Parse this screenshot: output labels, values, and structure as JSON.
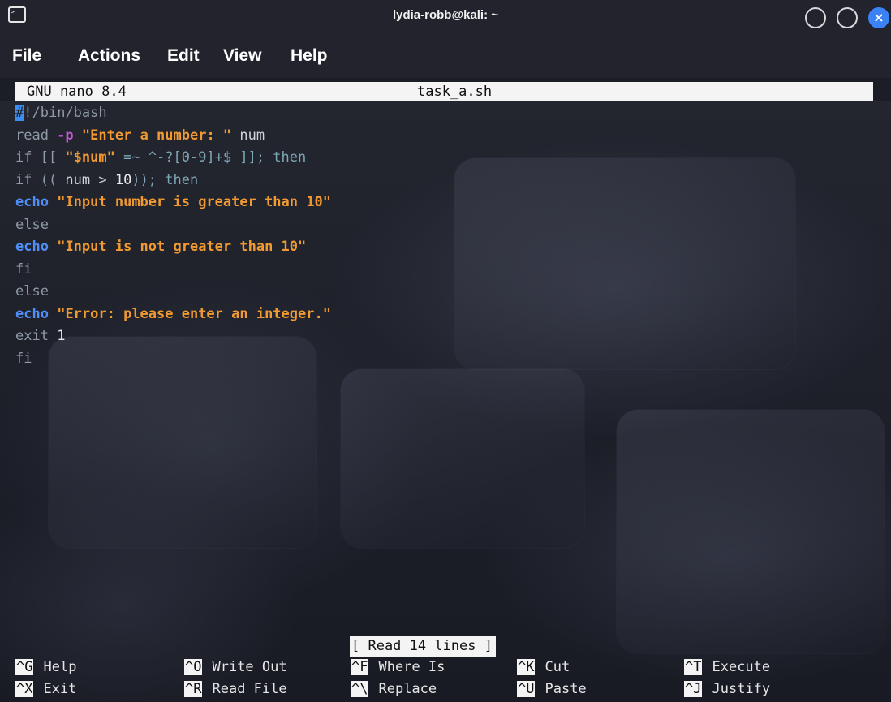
{
  "window": {
    "title": "lydia-robb@kali: ~",
    "icon": "terminal-icon",
    "controls": [
      "minimize",
      "maximize",
      "close"
    ]
  },
  "menu": [
    "File",
    "Actions",
    "Edit",
    "View",
    "Help"
  ],
  "nano": {
    "version": "GNU nano 8.4",
    "filename": "task_a.sh",
    "status": "[ Read 14 lines ]"
  },
  "code_lines": [
    [
      {
        "t": "#",
        "c": "cursor"
      },
      {
        "t": "!/bin/bash",
        "c": "c-grey"
      }
    ],
    [
      {
        "t": "read ",
        "c": "c-grey"
      },
      {
        "t": "-p",
        "c": "c-purple"
      },
      {
        "t": " ",
        "c": "c-plain"
      },
      {
        "t": "\"Enter a number: \"",
        "c": "c-orange"
      },
      {
        "t": " num",
        "c": "c-plain"
      }
    ],
    [
      {
        "t": "if [[ ",
        "c": "c-grey"
      },
      {
        "t": "\"$num\"",
        "c": "c-orange"
      },
      {
        "t": " =~ ^-?[0-9]+$ ]]; then",
        "c": "c-cyan"
      }
    ],
    [
      {
        "t": "if (( ",
        "c": "c-grey"
      },
      {
        "t": "num > ",
        "c": "c-plain"
      },
      {
        "t": "10",
        "c": "c-white"
      },
      {
        "t": ")); then",
        "c": "c-cyan"
      }
    ],
    [
      {
        "t": "echo",
        "c": "c-blue"
      },
      {
        "t": " ",
        "c": "c-plain"
      },
      {
        "t": "\"Input number is greater than 10\"",
        "c": "c-orange"
      }
    ],
    [
      {
        "t": "else",
        "c": "c-grey"
      }
    ],
    [
      {
        "t": "echo",
        "c": "c-blue"
      },
      {
        "t": " ",
        "c": "c-plain"
      },
      {
        "t": "\"Input is not greater than 10\"",
        "c": "c-orange"
      }
    ],
    [
      {
        "t": "fi",
        "c": "c-grey"
      }
    ],
    [
      {
        "t": "else",
        "c": "c-grey"
      }
    ],
    [
      {
        "t": "echo",
        "c": "c-blue"
      },
      {
        "t": " ",
        "c": "c-plain"
      },
      {
        "t": "\"Error: please enter an integer.\"",
        "c": "c-orange"
      }
    ],
    [
      {
        "t": "exit ",
        "c": "c-grey"
      },
      {
        "t": "1",
        "c": "c-white"
      }
    ],
    [
      {
        "t": "fi",
        "c": "c-grey"
      }
    ]
  ],
  "shortcuts": [
    {
      "key": "^G",
      "label": "Help"
    },
    {
      "key": "^O",
      "label": "Write Out"
    },
    {
      "key": "^F",
      "label": "Where Is"
    },
    {
      "key": "^K",
      "label": "Cut"
    },
    {
      "key": "^T",
      "label": "Execute"
    },
    {
      "key": "^X",
      "label": "Exit"
    },
    {
      "key": "^R",
      "label": "Read File"
    },
    {
      "key": "^\\",
      "label": "Replace"
    },
    {
      "key": "^U",
      "label": "Paste"
    },
    {
      "key": "^J",
      "label": "Justify"
    }
  ],
  "colors": {
    "titlebar": "#22232c",
    "header_bg": "#f4f4f4",
    "string": "#f19a32",
    "keyword": "#4f8ef7",
    "option": "#c257d8",
    "close_button": "#3b82f6"
  }
}
